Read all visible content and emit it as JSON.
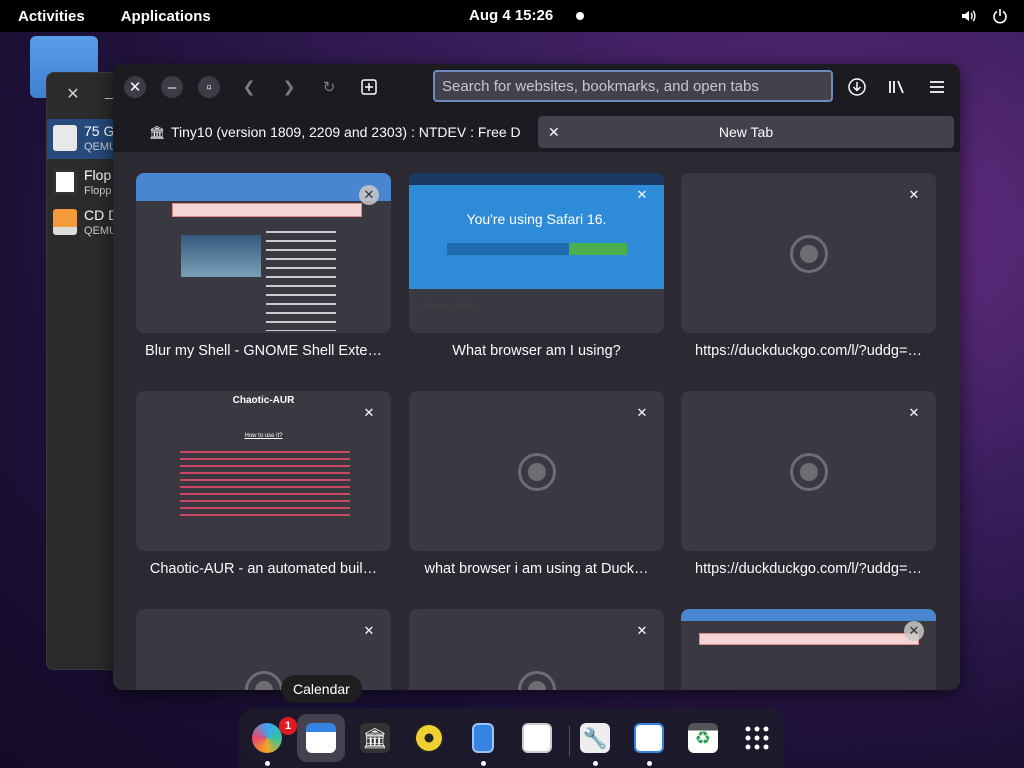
{
  "topbar": {
    "activities": "Activities",
    "applications": "Applications",
    "clock": "Aug 4  15:26"
  },
  "bg_window": {
    "items": [
      {
        "title": "75 G",
        "subtitle": "QEMU"
      },
      {
        "title": "Flop",
        "subtitle": "Flopp"
      },
      {
        "title": "CD D",
        "subtitle": "QEMU"
      }
    ]
  },
  "browser": {
    "url_placeholder": "Search for websites, bookmarks, and open tabs",
    "tabs": [
      {
        "label": "Tiny10 (version 1809, 2209 and 2303) : NTDEV : Free D"
      },
      {
        "label": "New Tab"
      }
    ],
    "tiles": [
      {
        "title": "Blur my Shell - GNOME Shell Exte…"
      },
      {
        "title": "What browser am I using?",
        "thumb_text": "You're using Safari 16.",
        "thumb_sub": "Browser details"
      },
      {
        "title": "https://duckduckgo.com/l/?uddg=…"
      },
      {
        "title": "Chaotic-AUR - an automated buil…",
        "thumb_text": "Chaotic-AUR",
        "thumb_sub": "How to use it?"
      },
      {
        "title": "what browser i am using at Duck…"
      },
      {
        "title": "https://duckduckgo.com/l/?uddg=…"
      },
      {
        "title": ""
      },
      {
        "title": ""
      },
      {
        "title": ""
      }
    ]
  },
  "tooltip": "Calendar",
  "dock": {
    "badge_count": "1"
  }
}
